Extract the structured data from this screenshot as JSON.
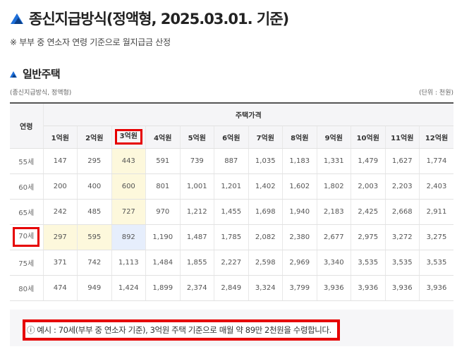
{
  "page": {
    "title": "종신지급방식(정액형, 2025.03.01. 기준)",
    "note": "※ 부부 중 연소자 연령 기준으로 월지급금 산정"
  },
  "section": {
    "title": "일반주택",
    "subtitle": "(종신지급방식, 정액형)",
    "unit": "(단위 : 천원)"
  },
  "table": {
    "age_header": "연령",
    "price_header": "주택가격",
    "columns": [
      "1억원",
      "2억원",
      "3억원",
      "4억원",
      "5억원",
      "6억원",
      "7억원",
      "8억원",
      "9억원",
      "10억원",
      "11억원",
      "12억원"
    ],
    "rows": [
      {
        "age": "55세",
        "values": [
          "147",
          "295",
          "443",
          "591",
          "739",
          "887",
          "1,035",
          "1,183",
          "1,331",
          "1,479",
          "1,627",
          "1,774"
        ]
      },
      {
        "age": "60세",
        "values": [
          "200",
          "400",
          "600",
          "801",
          "1,001",
          "1,201",
          "1,402",
          "1,602",
          "1,802",
          "2,003",
          "2,203",
          "2,403"
        ]
      },
      {
        "age": "65세",
        "values": [
          "242",
          "485",
          "727",
          "970",
          "1,212",
          "1,455",
          "1,698",
          "1,940",
          "2,183",
          "2,425",
          "2,668",
          "2,911"
        ]
      },
      {
        "age": "70세",
        "values": [
          "297",
          "595",
          "892",
          "1,190",
          "1,487",
          "1,785",
          "2,082",
          "2,380",
          "2,677",
          "2,975",
          "3,272",
          "3,275"
        ]
      },
      {
        "age": "75세",
        "values": [
          "371",
          "742",
          "1,113",
          "1,484",
          "1,855",
          "2,227",
          "2,598",
          "2,969",
          "3,340",
          "3,535",
          "3,535",
          "3,535"
        ]
      },
      {
        "age": "80세",
        "values": [
          "474",
          "949",
          "1,424",
          "1,899",
          "2,374",
          "2,849",
          "3,324",
          "3,799",
          "3,936",
          "3,936",
          "3,936",
          "3,936"
        ]
      }
    ]
  },
  "example": {
    "text": "예시 : 70세(부부 중 연소자 기준), 3억원 주택 기준으로 매월 약 89만 2천원을 수령합니다."
  },
  "colors": {
    "highlight_red": "#e60000",
    "highlight_yellow": "#fdf8dc",
    "highlight_blue": "#e6eefc",
    "icon_blue": "#1e6fd9"
  },
  "icons": {
    "title_icon": "mountain-logo-icon",
    "section_icon": "mountain-bullet-icon",
    "example_icon": "info-circle-icon"
  }
}
